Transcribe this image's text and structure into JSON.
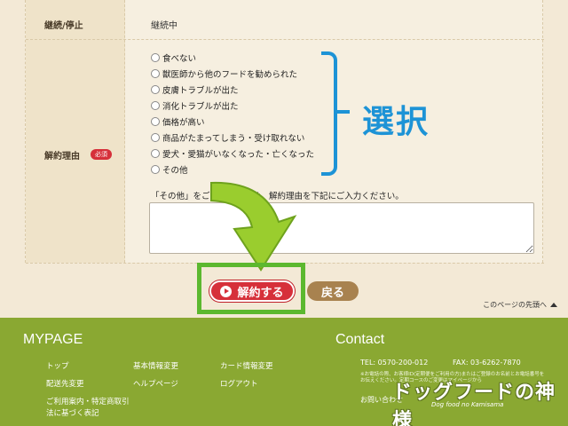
{
  "form": {
    "row1_label": "継続/停止",
    "row1_value": "継続中",
    "row2_label": "解約理由",
    "required_badge": "必須",
    "reasons": [
      "食べない",
      "獣医師から他のフードを勧められた",
      "皮膚トラブルが出た",
      "消化トラブルが出た",
      "価格が高い",
      "商品がたまってしまう・受け取れない",
      "愛犬・愛猫がいなくなった・亡くなった",
      "その他"
    ],
    "other_note": "「その他」をご選択の場合は、解約理由を下記にご入力ください。",
    "annotation": "選択"
  },
  "buttons": {
    "cancel_label": "解約する",
    "back_label": "戻る"
  },
  "page_top": "このページの先頭へ",
  "footer": {
    "mypage_title": "MYPAGE",
    "links": [
      "トップ",
      "基本情報変更",
      "カード情報変更",
      "配送先変更",
      "ヘルプページ",
      "ログアウト",
      "ご利用案内・特定商取引",
      "法に基づく表記"
    ],
    "contact_title": "Contact",
    "tel": "TEL: 0570-200-012",
    "fax": "FAX: 03-6262-7870",
    "contact_note": "※お電話の際、お客様ID(定期便をご利用の方)またはご登録のお名前とお電話番号をお伝えください。定期コースのご変更はマイページから",
    "inquiry": "お問い合わせ",
    "logo_text": "ドッグフードの神様",
    "logo_sub": "Dog food no Kamisama"
  },
  "colors": {
    "accent_blue": "#1d93d6",
    "cancel_red": "#d6303a",
    "highlight_green": "#5cb82f",
    "footer_green": "#8aa832"
  }
}
